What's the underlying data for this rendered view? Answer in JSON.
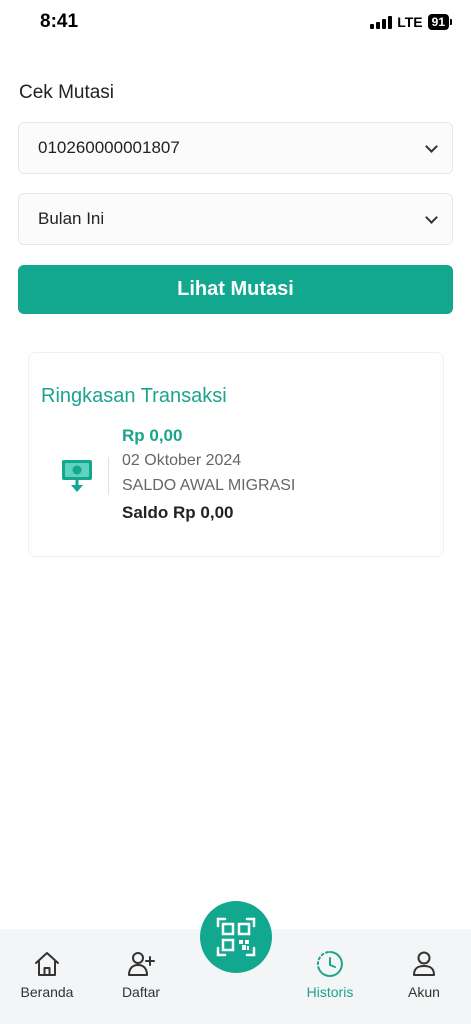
{
  "status_bar": {
    "time": "8:41",
    "network": "LTE",
    "battery": "91"
  },
  "page": {
    "title": "Cek Mutasi"
  },
  "form": {
    "account_select": {
      "value": "010260000001807"
    },
    "period_select": {
      "value": "Bulan Ini"
    },
    "submit_label": "Lihat Mutasi"
  },
  "summary": {
    "title": "Ringkasan Transaksi",
    "transactions": [
      {
        "amount": "Rp 0,00",
        "date": "02 Oktober 2024",
        "description": "SALDO AWAL MIGRASI",
        "balance": "Saldo Rp 0,00",
        "icon": "cash-in-icon"
      }
    ]
  },
  "bottom_nav": {
    "items": [
      {
        "label": "Beranda",
        "icon": "home-icon"
      },
      {
        "label": "Daftar",
        "icon": "add-user-icon"
      },
      {
        "label": "Historis",
        "icon": "history-icon",
        "active": true
      },
      {
        "label": "Akun",
        "icon": "user-icon"
      }
    ],
    "center_icon": "qr-code-icon"
  },
  "colors": {
    "accent": "#12a88f",
    "accent_text": "#1aa48e",
    "nav_bg": "#f4f5f6"
  }
}
